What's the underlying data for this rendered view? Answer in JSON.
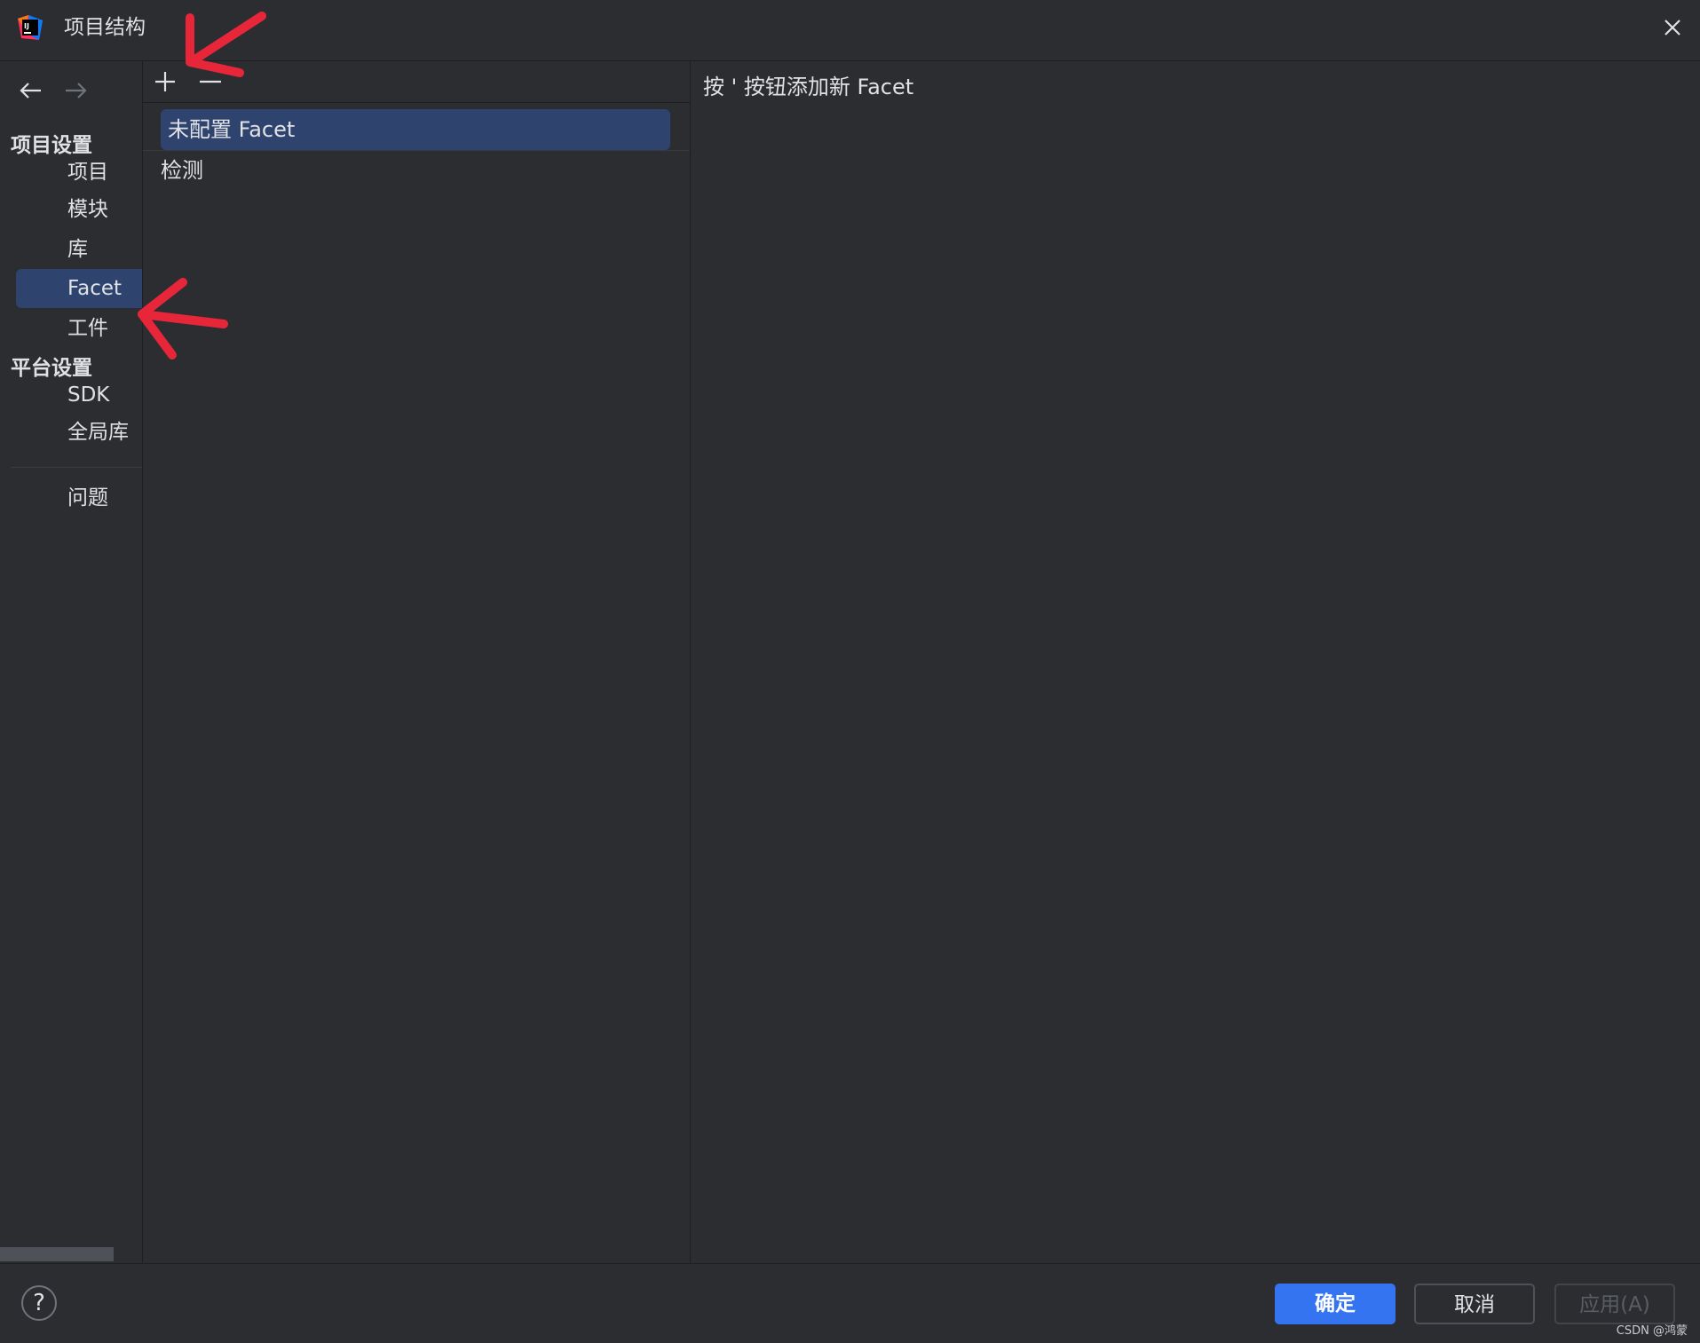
{
  "window": {
    "title": "项目结构",
    "logo_icon": "intellij-idea-logo",
    "close_icon": "close-icon"
  },
  "nav": {
    "back_icon": "arrow-left-icon",
    "forward_icon": "arrow-right-icon",
    "sections": [
      {
        "title": "项目设置",
        "items": [
          "项目",
          "模块",
          "库",
          "Facet",
          "工件"
        ]
      },
      {
        "title": "平台设置",
        "items": [
          "SDK",
          "全局库"
        ]
      }
    ],
    "problems_label": "问题",
    "selected": "Facet"
  },
  "facets": {
    "add_icon": "plus-icon",
    "remove_icon": "minus-icon",
    "rows": [
      "未配置 Facet",
      "检测"
    ],
    "selected": "未配置 Facet"
  },
  "detail": {
    "hint": "按 ' 按钮添加新 Facet"
  },
  "footer": {
    "help_label": "?",
    "ok_label": "确定",
    "cancel_label": "取消",
    "apply_label": "应用(A)",
    "watermark": "CSDN @鸿蒙"
  },
  "colors": {
    "background": "#2b2d30",
    "selection": "#2e436e",
    "accent": "#3574f0",
    "annotation": "#e8263a"
  }
}
